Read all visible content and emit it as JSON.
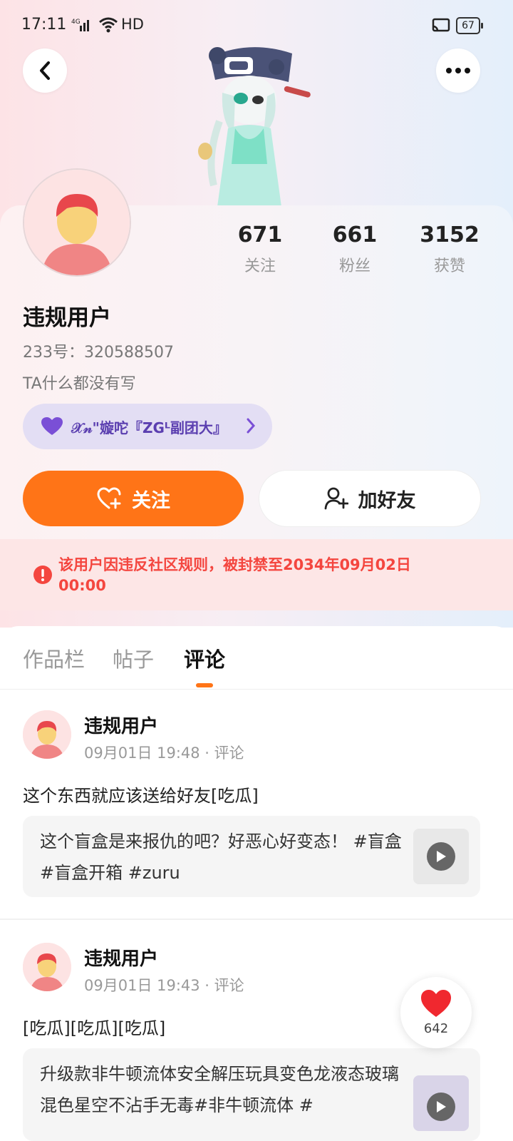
{
  "status": {
    "time": "17:11",
    "network": "4G",
    "hd": "HD",
    "battery": "67"
  },
  "profile": {
    "name": "违规用户",
    "uid": "233号：320588507",
    "bio": "TA什么都没有写",
    "club": "𝒳𝓃\"嫙咜『ZGᴸ副团大』"
  },
  "stats": [
    {
      "value": "671",
      "label": "关注"
    },
    {
      "value": "661",
      "label": "粉丝"
    },
    {
      "value": "3152",
      "label": "获赞"
    }
  ],
  "actions": {
    "follow": "关注",
    "add_friend": "加好友"
  },
  "ban_notice": "该用户因违反社区规则，被封禁至2034年09月02日00:00",
  "tabs": [
    "作品栏",
    "帖子",
    "评论"
  ],
  "comments": [
    {
      "author": "违规用户",
      "meta": "09月01日 19:48 · 评论",
      "text": "这个东西就应该送给好友[吃瓜]",
      "quote": "这个盲盒是来报仇的吧？好恶心好变态！ #盲盒 #盲盒开箱 #zuru"
    },
    {
      "author": "违规用户",
      "meta": "09月01日 19:43 · 评论",
      "text": "[吃瓜][吃瓜][吃瓜]",
      "quote": "升级款非牛顿流体安全解压玩具变色龙液态玻璃混色星空不沾手无毒#非牛顿流体 #"
    }
  ],
  "like_float": {
    "count": "642"
  },
  "colors": {
    "accent": "#ff7417",
    "ban_text": "#f4463f",
    "club_bg": "#e3def4"
  }
}
